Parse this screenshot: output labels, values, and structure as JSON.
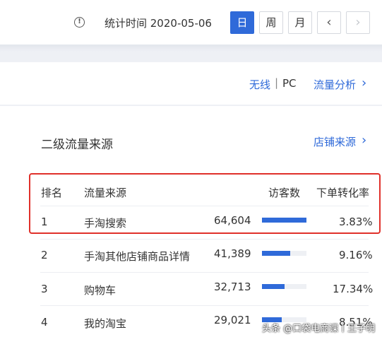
{
  "header": {
    "stat_time": "统计时间 2020-05-06",
    "info_icon": "info-circle-icon",
    "periods": [
      {
        "label": "日",
        "active": true
      },
      {
        "label": "周",
        "active": false
      },
      {
        "label": "月",
        "active": false
      }
    ],
    "prev": "‹",
    "next": "›"
  },
  "device": {
    "wireless": "无线",
    "separator": "|",
    "pc": "PC",
    "analysis_link": "流量分析",
    "analysis_arrow": "›"
  },
  "section": {
    "title": "二级流量来源",
    "shop_source_link": "店铺来源",
    "shop_source_arrow": "›"
  },
  "table": {
    "headers": {
      "rank": "排名",
      "source": "流量来源",
      "visitors": "访客数",
      "conversion": "下单转化率"
    },
    "rows": [
      {
        "rank": "1",
        "source": "手淘搜索",
        "visitors": "64,604",
        "bar_ratio": 1.0,
        "conversion": "3.83%"
      },
      {
        "rank": "2",
        "source": "手淘其他店铺商品详情",
        "visitors": "41,389",
        "bar_ratio": 0.64,
        "conversion": "9.16%"
      },
      {
        "rank": "3",
        "source": "购物车",
        "visitors": "32,713",
        "bar_ratio": 0.51,
        "conversion": "17.34%"
      },
      {
        "rank": "4",
        "source": "我的淘宝",
        "visitors": "29,021",
        "bar_ratio": 0.45,
        "conversion": "8.51%"
      }
    ]
  },
  "watermark": "头条 @口袋电商课丨王子明",
  "colors": {
    "accent": "#2f6ad9",
    "highlight_border": "#e0302a"
  }
}
